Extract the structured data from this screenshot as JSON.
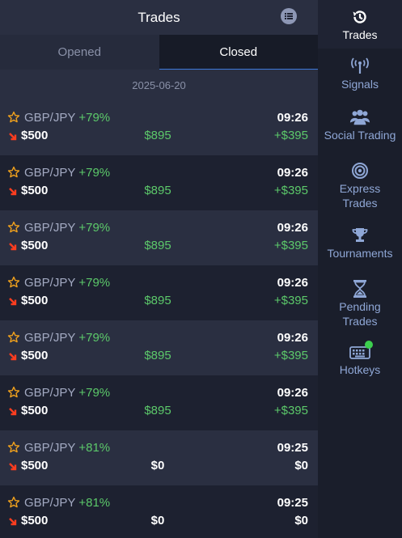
{
  "panel": {
    "title": "Trades",
    "tabs": {
      "opened": "Opened",
      "closed": "Closed"
    },
    "date": "2025-06-20"
  },
  "trades": [
    {
      "pair": "GBP/JPY",
      "payout": "+79%",
      "amount": "$500",
      "result": "$895",
      "time": "09:26",
      "profit": "+$395",
      "status": "win"
    },
    {
      "pair": "GBP/JPY",
      "payout": "+79%",
      "amount": "$500",
      "result": "$895",
      "time": "09:26",
      "profit": "+$395",
      "status": "win"
    },
    {
      "pair": "GBP/JPY",
      "payout": "+79%",
      "amount": "$500",
      "result": "$895",
      "time": "09:26",
      "profit": "+$395",
      "status": "win"
    },
    {
      "pair": "GBP/JPY",
      "payout": "+79%",
      "amount": "$500",
      "result": "$895",
      "time": "09:26",
      "profit": "+$395",
      "status": "win"
    },
    {
      "pair": "GBP/JPY",
      "payout": "+79%",
      "amount": "$500",
      "result": "$895",
      "time": "09:26",
      "profit": "+$395",
      "status": "win"
    },
    {
      "pair": "GBP/JPY",
      "payout": "+79%",
      "amount": "$500",
      "result": "$895",
      "time": "09:26",
      "profit": "+$395",
      "status": "win"
    },
    {
      "pair": "GBP/JPY",
      "payout": "+81%",
      "amount": "$500",
      "result": "$0",
      "time": "09:25",
      "profit": "$0",
      "status": "zero"
    },
    {
      "pair": "GBP/JPY",
      "payout": "+81%",
      "amount": "$500",
      "result": "$0",
      "time": "09:25",
      "profit": "$0",
      "status": "zero"
    }
  ],
  "sidebar": {
    "trades": "Trades",
    "signals": "Signals",
    "social": "Social Trading",
    "express_1": "Express",
    "express_2": "Trades",
    "tournaments": "Tournaments",
    "pending_1": "Pending",
    "pending_2": "Trades",
    "hotkeys": "Hotkeys"
  },
  "colors": {
    "win": "#5cc96a",
    "accent": "#3e79d9",
    "star": "#f0a11d",
    "down_arrow": "#ff3d1f"
  }
}
